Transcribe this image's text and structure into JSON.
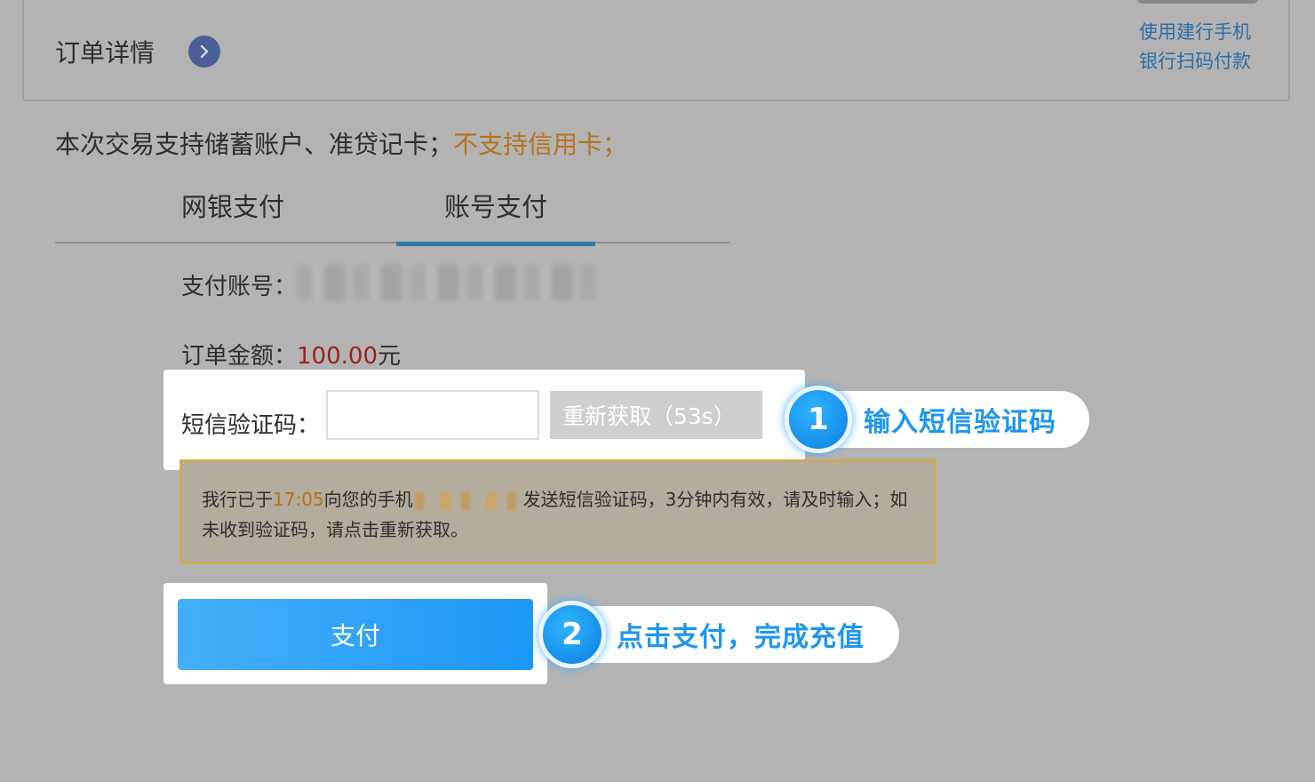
{
  "header": {
    "order_detail_label": "订单详情",
    "mobile_scan_line1": "使用建行手机",
    "mobile_scan_line2": "银行扫码付款"
  },
  "notice": {
    "supported_text": "本次交易支持储蓄账户、准贷记卡；",
    "unsupported_text": "不支持信用卡；"
  },
  "tabs": [
    {
      "label": "网银支付",
      "active": false
    },
    {
      "label": "账号支付",
      "active": true
    }
  ],
  "form": {
    "account_label": "支付账号：",
    "amount_label": "订单金额：",
    "amount_value": "100.00",
    "amount_unit": "元",
    "sms_label": "短信验证码：",
    "sms_value": "",
    "resend_label": "重新获取（53s）",
    "resend_countdown_seconds": 53
  },
  "sms_tip": {
    "prefix": "我行已于",
    "time": "17:05",
    "mid": "向您的手机",
    "suffix": "发送短信验证码，3分钟内有效，请及时输入；如未收到验证码，请点击重新获取。"
  },
  "pay_button_label": "支付",
  "callouts": [
    {
      "number": "1",
      "text": "输入短信验证码"
    },
    {
      "number": "2",
      "text": "点击支付，完成充值"
    }
  ],
  "colors": {
    "overlay_gray": "#b3b3b3",
    "link_blue": "#2d6ea7",
    "warn_orange": "#b5731c",
    "amount_red": "#9c1f1f",
    "pay_blue": "#1d97f6",
    "callout_blue": "#1f96f0"
  },
  "icons": {
    "order_toggle": "chevron-right-icon"
  }
}
